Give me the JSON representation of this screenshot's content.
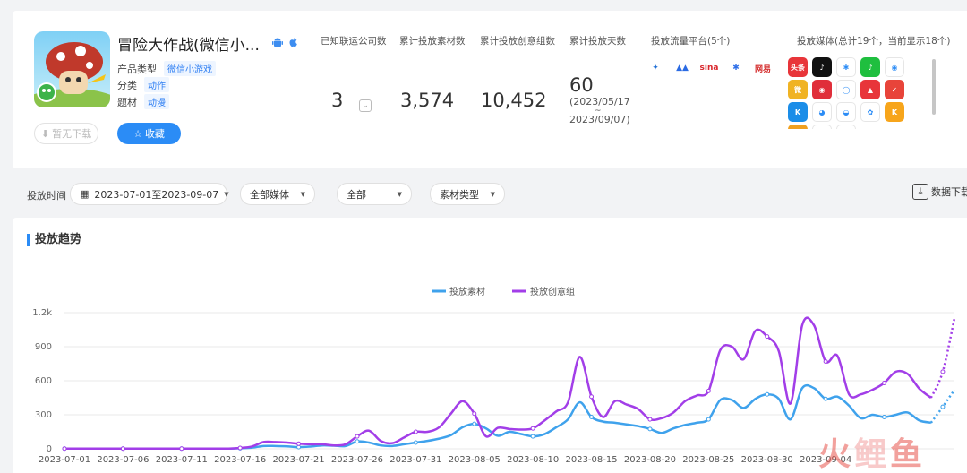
{
  "app": {
    "name": "冒险大作战(微信小...",
    "product_type_label": "产品类型",
    "product_type": "微信小游戏",
    "category_label": "分类",
    "category": "动作",
    "theme_label": "题材",
    "theme": "动漫",
    "no_download_label": "暂无下载",
    "favorite_label": "收藏"
  },
  "stats": {
    "companies_label": "已知联运公司数",
    "companies_value": "3",
    "materials_label": "累计投放素材数",
    "materials_value": "3,574",
    "creatives_label": "累计投放创意组数",
    "creatives_value": "10,452",
    "days_label": "累计投放天数",
    "days_value": "60",
    "days_start": "(2023/05/17",
    "days_tilde": "~",
    "days_end": "2023/09/07)"
  },
  "platforms": {
    "label": "投放流量平台(5个)",
    "items": [
      {
        "icon": "tencent-ads-icon",
        "text": "✦",
        "color": "#1f6fd6"
      },
      {
        "icon": "ocean-engine-icon",
        "text": "▲▲",
        "color": "#2b6be3"
      },
      {
        "icon": "sina-icon",
        "text": "sina",
        "color": "#d9262c"
      },
      {
        "icon": "baidu-icon",
        "text": "✱",
        "color": "#2f6fe8"
      },
      {
        "icon": "netease-icon",
        "text": "网易",
        "color": "#d42c2c"
      }
    ]
  },
  "media": {
    "label": "投放媒体(总计19个，当前显示18个)",
    "items": [
      {
        "icon": "toutiao-icon",
        "text": "头条",
        "color": "#e8353a"
      },
      {
        "icon": "douyin-icon",
        "text": "♪",
        "color": "#111111"
      },
      {
        "icon": "baidu-paw-icon",
        "text": "✱",
        "color": "#ffffff"
      },
      {
        "icon": "iqiyi-icon",
        "text": "♪",
        "color": "#1fbf3f"
      },
      {
        "icon": "tencent-video-icon",
        "text": "◉",
        "color": "#ffffff"
      },
      {
        "icon": "weibo-icon",
        "text": "微",
        "color": "#f0b323"
      },
      {
        "icon": "location-icon",
        "text": "◉",
        "color": "#e02e3a"
      },
      {
        "icon": "circle-app-icon",
        "text": "◯",
        "color": "#ffffff"
      },
      {
        "icon": "kuaishou-icon",
        "text": "▲",
        "color": "#e8353a"
      },
      {
        "icon": "sign-app-icon",
        "text": "✓",
        "color": "#e8443a"
      },
      {
        "icon": "k-app-icon",
        "text": "K",
        "color": "#1b8de8"
      },
      {
        "icon": "qq-icon",
        "text": "◕",
        "color": "#ffffff"
      },
      {
        "icon": "qq-browser-icon",
        "text": "◒",
        "color": "#ffffff"
      },
      {
        "icon": "gourd-app-icon",
        "text": "✿",
        "color": "#ffffff"
      },
      {
        "icon": "kuaidian-icon",
        "text": "K",
        "color": "#f7a51b"
      },
      {
        "icon": "orange-app-icon",
        "text": "●",
        "color": "#f0a020"
      },
      {
        "icon": "partial-app-icon",
        "text": "•",
        "color": "#ffffff"
      },
      {
        "icon": "partial-app-icon-2",
        "text": "•",
        "color": "#ffffff"
      }
    ]
  },
  "filters": {
    "time_label": "投放时间",
    "date_range": "2023-07-01至2023-09-07",
    "media_select": "全部媒体",
    "all_select": "全部",
    "material_type_select": "素材类型",
    "download_label": "数据下载"
  },
  "section": {
    "title": "投放趋势"
  },
  "watermark": "火鲤鱼",
  "colors": {
    "series_materials": "#3fa2ec",
    "series_creatives": "#a23ee8",
    "primary": "#2b8cf6"
  },
  "chart_data": {
    "type": "line",
    "ylim": [
      0,
      1200
    ],
    "yticks": [
      "0",
      "300",
      "600",
      "900",
      "1.2k"
    ],
    "x_tick_labels": [
      "2023-07-01",
      "2023-07-06",
      "2023-07-11",
      "2023-07-16",
      "2023-07-21",
      "2023-07-26",
      "2023-07-31",
      "2023-08-05",
      "2023-08-10",
      "2023-08-15",
      "2023-08-20",
      "2023-08-25",
      "2023-08-30",
      "2023-09-04"
    ],
    "legend_position": "top-center",
    "x_start": "2023-07-01",
    "series": [
      {
        "name": "投放素材",
        "values": [
          2,
          2,
          2,
          2,
          2,
          2,
          2,
          2,
          2,
          2,
          2,
          2,
          2,
          2,
          2,
          5,
          10,
          25,
          25,
          22,
          15,
          20,
          30,
          28,
          25,
          65,
          55,
          30,
          25,
          40,
          55,
          70,
          90,
          120,
          190,
          220,
          180,
          115,
          150,
          130,
          110,
          130,
          190,
          260,
          410,
          280,
          240,
          230,
          215,
          200,
          175,
          140,
          180,
          210,
          230,
          260,
          430,
          430,
          360,
          440,
          480,
          440,
          260,
          535,
          535,
          440,
          460,
          380,
          270,
          300,
          280,
          300,
          320,
          250,
          230,
          370,
          520
        ],
        "dashed_from_index": 74
      },
      {
        "name": "投放创意组",
        "values": [
          2,
          2,
          2,
          2,
          2,
          2,
          2,
          2,
          2,
          2,
          2,
          2,
          2,
          2,
          2,
          8,
          20,
          60,
          60,
          55,
          45,
          40,
          40,
          30,
          40,
          110,
          160,
          70,
          50,
          100,
          150,
          150,
          190,
          310,
          420,
          310,
          110,
          185,
          175,
          170,
          180,
          250,
          330,
          410,
          810,
          460,
          280,
          420,
          390,
          350,
          260,
          270,
          320,
          420,
          470,
          510,
          870,
          900,
          790,
          1040,
          990,
          860,
          400,
          1090,
          1090,
          770,
          820,
          480,
          480,
          520,
          580,
          680,
          660,
          530,
          450,
          680,
          1150
        ],
        "dashed_from_index": 74
      }
    ]
  }
}
